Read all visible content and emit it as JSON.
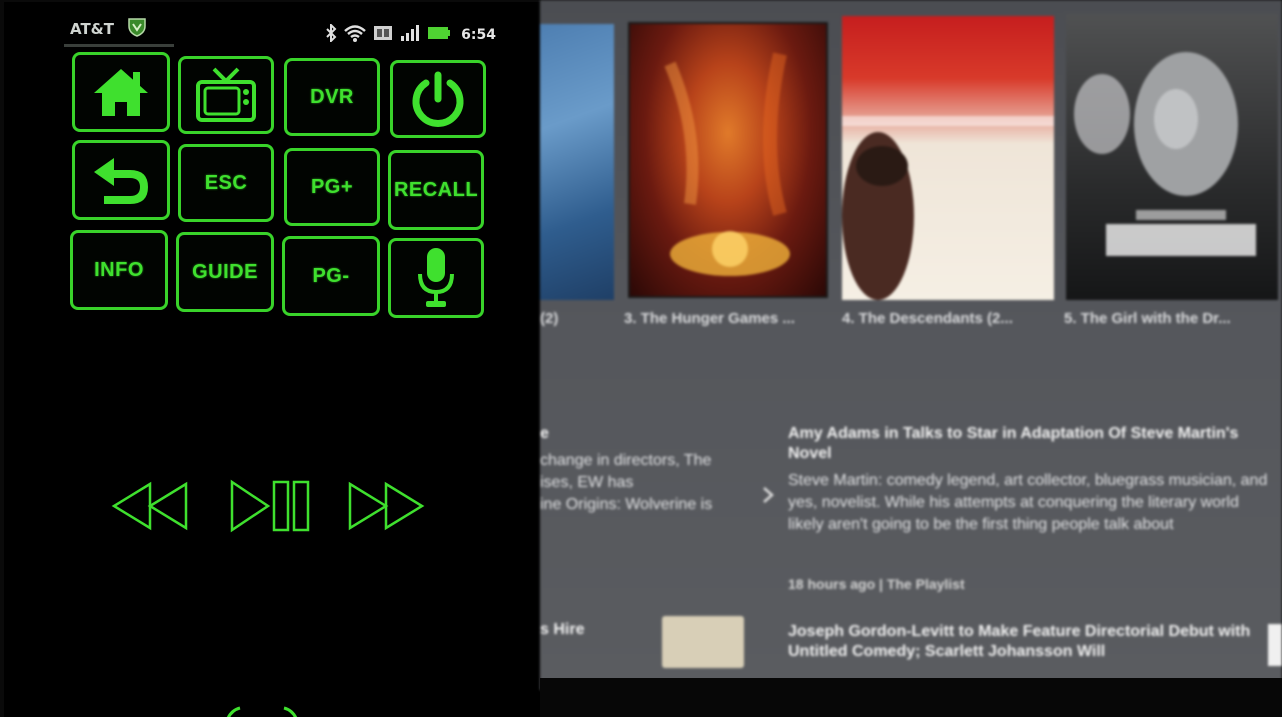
{
  "phone": {
    "status_bar": {
      "carrier": "AT&T",
      "time": "6:54"
    },
    "buttons": {
      "dvr": "DVR",
      "esc": "ESC",
      "pg_up": "PG+",
      "recall": "RECALL",
      "info": "INFO",
      "guide": "GUIDE",
      "pg_down": "PG-"
    },
    "icons": [
      "home-icon",
      "tv-icon",
      "power-icon",
      "back-arrow-icon",
      "microphone-icon",
      "rewind-icon",
      "play-pause-icon",
      "fast-forward-icon"
    ],
    "accent_color": "#39d32a"
  },
  "tv": {
    "posters": [
      {
        "caption": "3. The Hunger Games ..."
      },
      {
        "caption": "4. The Descendants (2..."
      },
      {
        "caption": "5. The Girl with the Dr..."
      }
    ],
    "partial_caption": "(2)",
    "left_news": {
      "title_fragment": "e",
      "lines": [
        "change in directors, The",
        "ises, EW has",
        "ine Origins: Wolverine is"
      ]
    },
    "right_news": {
      "title": "Amy Adams in Talks to Star in Adaptation Of Steve Martin's Novel",
      "body": "Steve Martin: comedy legend, art collector, bluegrass musician, and yes, novelist. While his attempts at conquering the literary world likely aren't going to be the first thing people talk about",
      "meta": "18 hours ago | The Playlist"
    },
    "bottom_left_fragment": "s Hire",
    "bottom_news_title": "Joseph Gordon-Levitt to Make Feature Directorial Debut with Untitled Comedy; Scarlett Johansson Will"
  }
}
